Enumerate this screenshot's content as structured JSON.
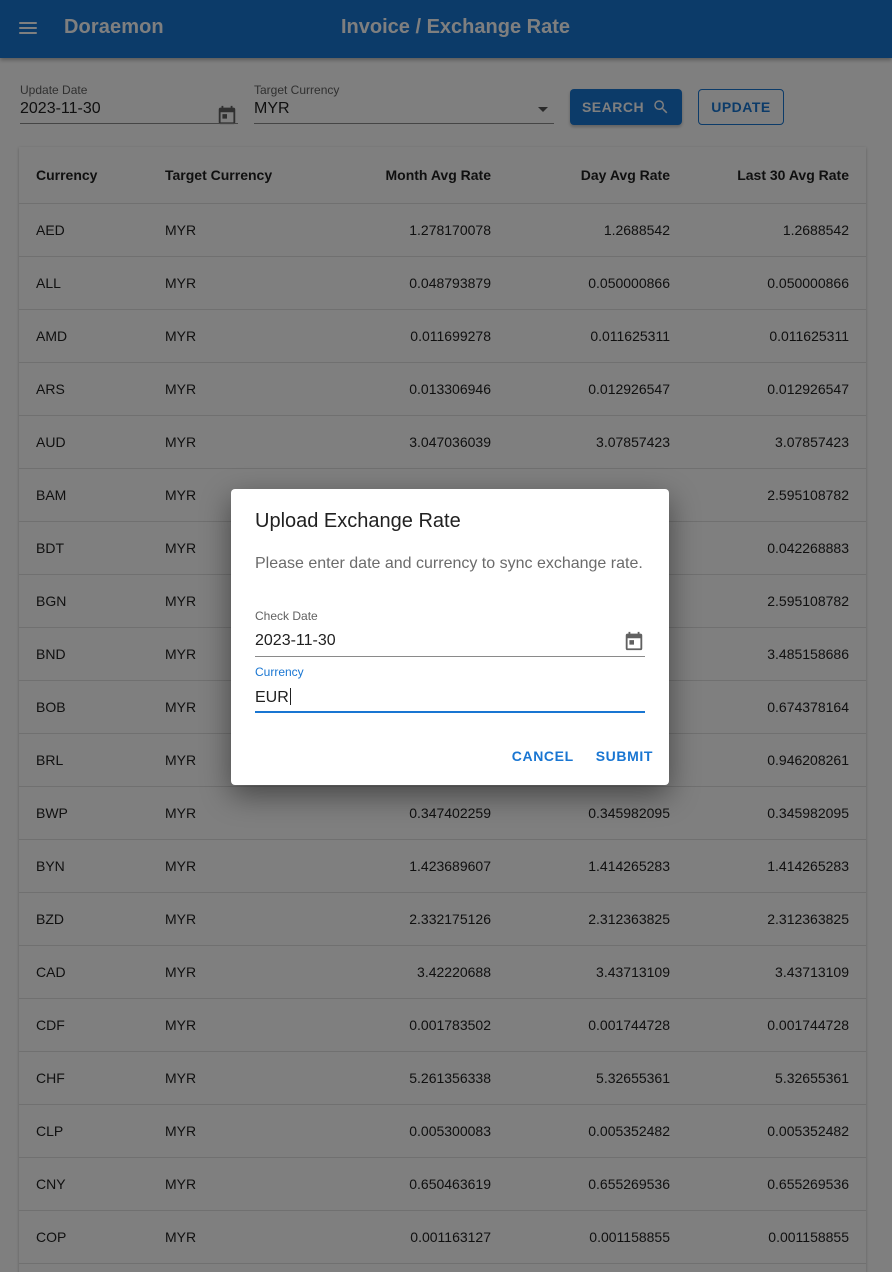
{
  "app": {
    "name": "Doraemon",
    "page_title": "Invoice / Exchange Rate"
  },
  "filters": {
    "update_date": {
      "label": "Update Date",
      "value": "2023-11-30"
    },
    "target_currency": {
      "label": "Target Currency",
      "value": "MYR"
    },
    "search_label": "SEARCH",
    "update_label": "UPDATE"
  },
  "table": {
    "columns": [
      "Currency",
      "Target Currency",
      "Month Avg Rate",
      "Day Avg Rate",
      "Last 30 Avg Rate"
    ],
    "rows": [
      [
        "AED",
        "MYR",
        "1.278170078",
        "1.2688542",
        "1.2688542"
      ],
      [
        "ALL",
        "MYR",
        "0.048793879",
        "0.050000866",
        "0.050000866"
      ],
      [
        "AMD",
        "MYR",
        "0.011699278",
        "0.011625311",
        "0.011625311"
      ],
      [
        "ARS",
        "MYR",
        "0.013306946",
        "0.012926547",
        "0.012926547"
      ],
      [
        "AUD",
        "MYR",
        "3.047036039",
        "3.07857423",
        "3.07857423"
      ],
      [
        "BAM",
        "MYR",
        "",
        "",
        "2.595108782"
      ],
      [
        "BDT",
        "MYR",
        "",
        "",
        "0.042268883"
      ],
      [
        "BGN",
        "MYR",
        "",
        "",
        "2.595108782"
      ],
      [
        "BND",
        "MYR",
        "",
        "",
        "3.485158686"
      ],
      [
        "BOB",
        "MYR",
        "",
        "",
        "0.674378164"
      ],
      [
        "BRL",
        "MYR",
        "",
        "",
        "0.946208261"
      ],
      [
        "BWP",
        "MYR",
        "0.347402259",
        "0.345982095",
        "0.345982095"
      ],
      [
        "BYN",
        "MYR",
        "1.423689607",
        "1.414265283",
        "1.414265283"
      ],
      [
        "BZD",
        "MYR",
        "2.332175126",
        "2.312363825",
        "2.312363825"
      ],
      [
        "CAD",
        "MYR",
        "3.42220688",
        "3.43713109",
        "3.43713109"
      ],
      [
        "CDF",
        "MYR",
        "0.001783502",
        "0.001744728",
        "0.001744728"
      ],
      [
        "CHF",
        "MYR",
        "5.261356338",
        "5.32655361",
        "5.32655361"
      ],
      [
        "CLP",
        "MYR",
        "0.005300083",
        "0.005352482",
        "0.005352482"
      ],
      [
        "CNY",
        "MYR",
        "0.650463619",
        "0.655269536",
        "0.655269536"
      ],
      [
        "COP",
        "MYR",
        "0.001163127",
        "0.001158855",
        "0.001158855"
      ]
    ]
  },
  "dialog": {
    "title": "Upload Exchange Rate",
    "text": "Please enter date and currency to sync exchange rate.",
    "check_date": {
      "label": "Check Date",
      "value": "2023-11-30"
    },
    "currency": {
      "label": "Currency",
      "value": "EUR"
    },
    "cancel_label": "CANCEL",
    "submit_label": "SUBMIT"
  },
  "colors": {
    "primary": "#1976d2",
    "overlay": "rgba(0,0,0,0.5)"
  },
  "icons": {
    "menu": "menu-icon",
    "calendar": "calendar-icon",
    "search": "search-icon",
    "dropdown": "chevron-down-icon"
  }
}
